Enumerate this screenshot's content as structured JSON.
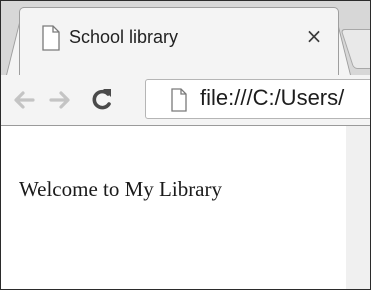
{
  "browser": {
    "tab": {
      "title": "School library",
      "close_symbol": "×",
      "favicon_icon": "page-icon",
      "close_icon": "close-icon"
    },
    "toolbar": {
      "back_icon": "arrow-left-icon",
      "forward_icon": "arrow-right-icon",
      "reload_icon": "reload-icon",
      "address": "file:///C:/Users/",
      "address_icon": "page-icon"
    }
  },
  "page": {
    "heading": "Welcome to My Library"
  },
  "colors": {
    "tabstrip": "#d7d7d7",
    "toolbar": "#f4f4f4",
    "nav_disabled": "#c4c4c4",
    "reload": "#4a4a4a",
    "text": "#1a1a1a"
  }
}
